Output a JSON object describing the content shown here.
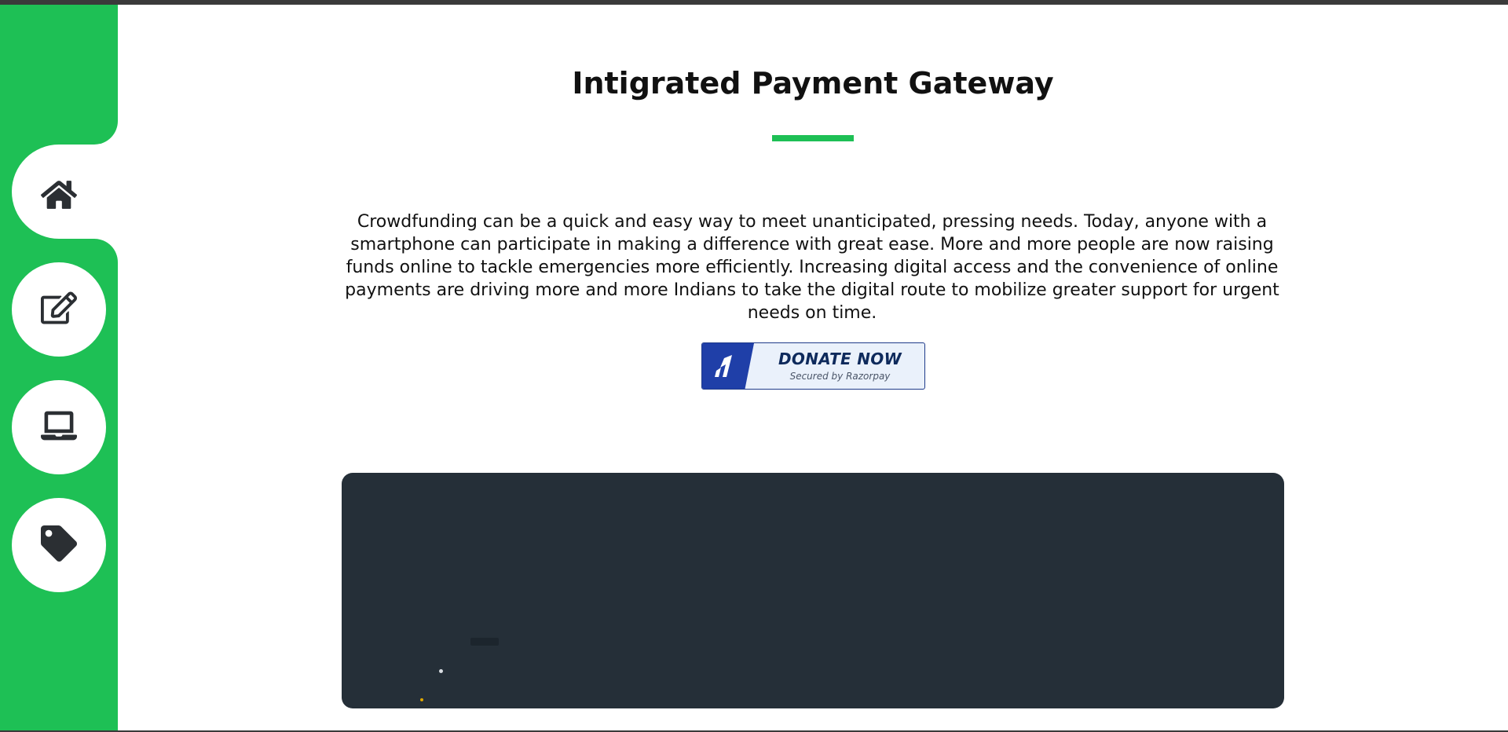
{
  "sidebar": {
    "accent_color": "#1ec055",
    "items": [
      {
        "icon": "home-icon",
        "active": true
      },
      {
        "icon": "edit-icon",
        "active": false
      },
      {
        "icon": "laptop-icon",
        "active": false
      },
      {
        "icon": "tag-icon",
        "active": false
      }
    ]
  },
  "main": {
    "title": "Intigrated Payment Gateway",
    "description": "Crowdfunding can be a quick and easy way to meet unanticipated, pressing needs. Today, anyone with a smartphone can participate in making a difference with great ease. More and more people are now raising funds online to tackle emergencies more efficiently. Increasing digital access and the convenience of online payments are driving more and more Indians to take the digital route to mobilize greater support for urgent needs on time.",
    "donate_button": {
      "label": "DONATE NOW",
      "secured_text": "Secured by Razorpay",
      "icon": "razorpay-logo-icon",
      "brand_color": "#1f3fa8"
    },
    "panel_color": "#252f38"
  }
}
